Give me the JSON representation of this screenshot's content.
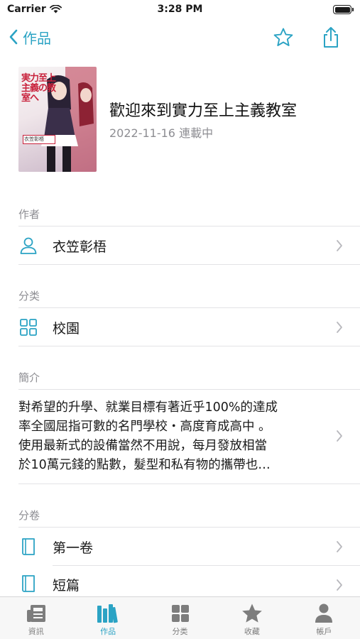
{
  "status_bar": {
    "carrier": "Carrier",
    "time": "3:28 PM"
  },
  "nav": {
    "back_label": "作品"
  },
  "book": {
    "title": "歡迎來到實力至上主義教室",
    "meta": "2022-11-16 連載中",
    "cover_title": "実力至上主義の教室へ",
    "cover_sub": "衣笠彰梧"
  },
  "sections": {
    "author": {
      "header": "作者",
      "value": "衣笠彰梧"
    },
    "category": {
      "header": "分类",
      "value": "校園"
    },
    "intro": {
      "header": "簡介",
      "lines": [
        "對希望的升學、就業目標有著近乎100%的達成",
        "率全國屈指可數的名門學校・高度育成高中 。",
        "使用最新式的設備當然不用說，每月發放相當",
        "於10萬元錢的點數，髮型和私有物的攜帶也…"
      ]
    },
    "volumes": {
      "header": "分卷",
      "items": [
        "第一卷",
        "短篇"
      ]
    }
  },
  "tabs": [
    {
      "label": "資訊",
      "icon": "news-icon",
      "active": false
    },
    {
      "label": "作品",
      "icon": "books-icon",
      "active": true
    },
    {
      "label": "分类",
      "icon": "grid-icon",
      "active": false
    },
    {
      "label": "收藏",
      "icon": "star-icon",
      "active": false
    },
    {
      "label": "帳戶",
      "icon": "person-icon",
      "active": false
    }
  ],
  "colors": {
    "accent": "#2ba3c4",
    "secondary_text": "#8e8e93",
    "tab_inactive": "#7d7d7d"
  }
}
